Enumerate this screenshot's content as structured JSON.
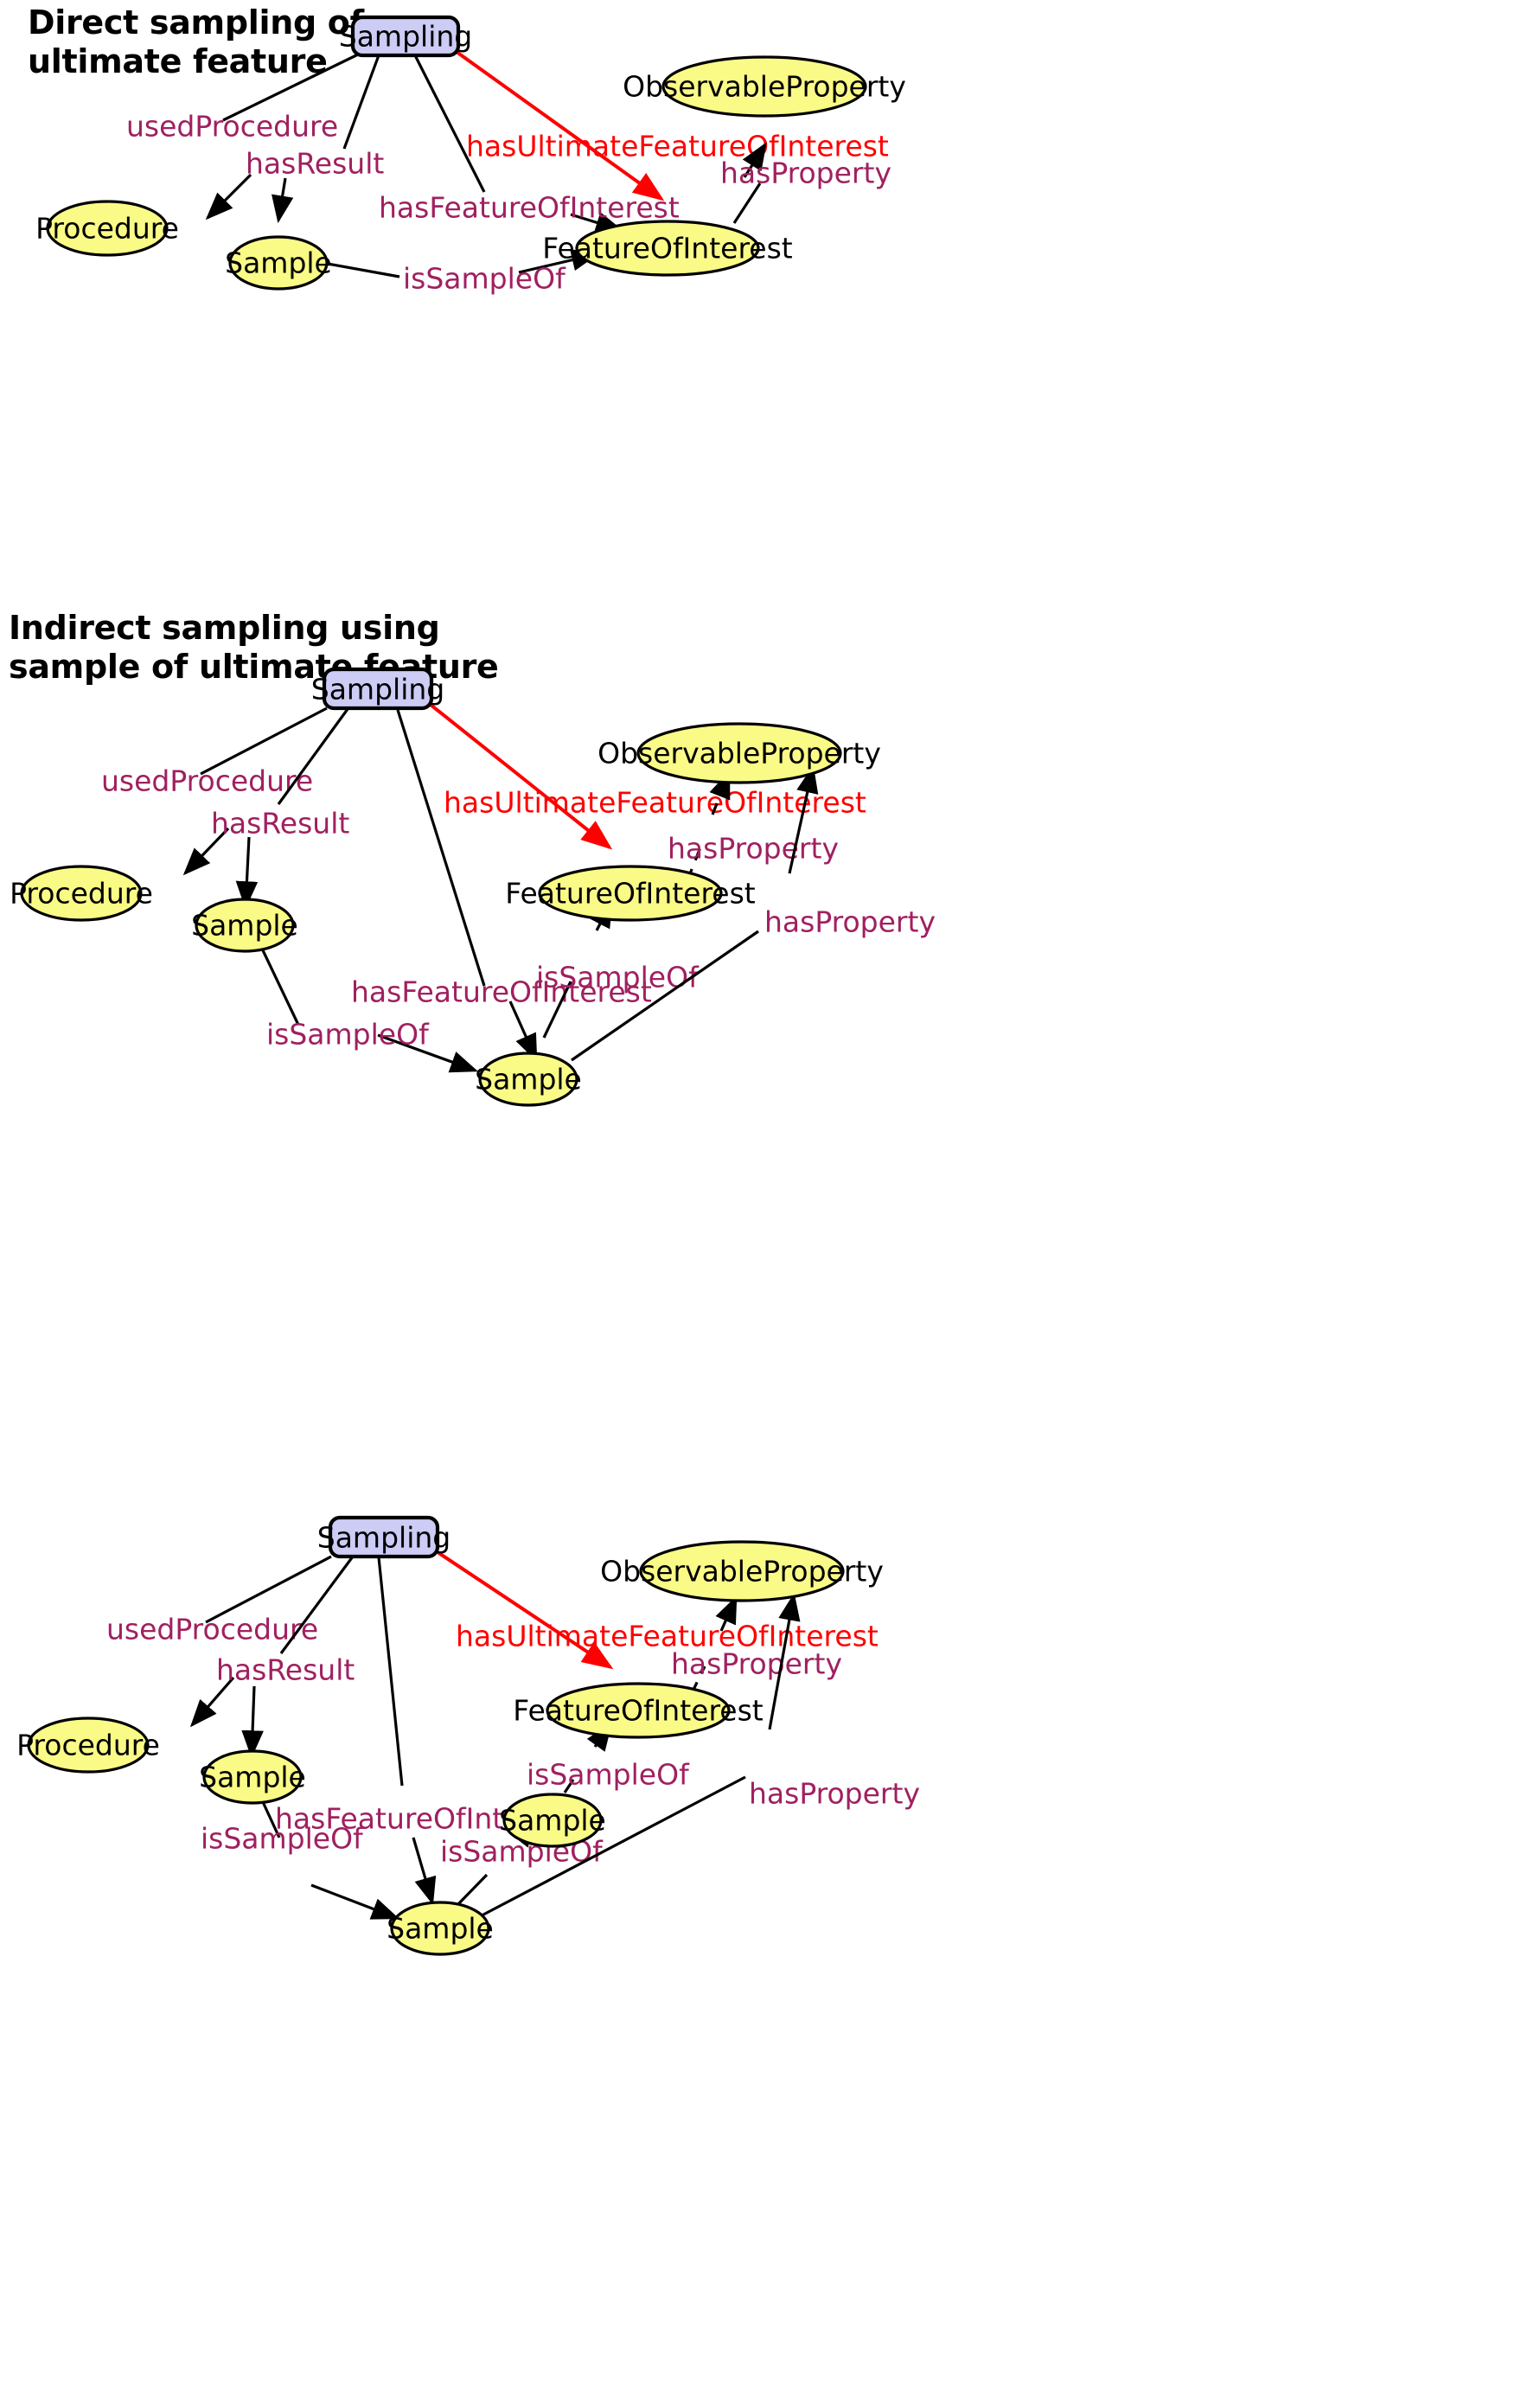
{
  "diagram": {
    "title_color": "#000000",
    "node_fill_ellipse": "#fafa87",
    "node_fill_box": "#ccccf5",
    "edge_label_color": "#a02060",
    "highlight_color": "#ff0000"
  },
  "panels": [
    {
      "id": "panel-direct",
      "title": "Direct sampling of\nultimate feature",
      "nodes": [
        {
          "id": "sampling",
          "label": "Sampling",
          "shape": "rounded-rect"
        },
        {
          "id": "procedure",
          "label": "Procedure",
          "shape": "ellipse"
        },
        {
          "id": "sample",
          "label": "Sample",
          "shape": "ellipse"
        },
        {
          "id": "foi",
          "label": "FeatureOfInterest",
          "shape": "ellipse"
        },
        {
          "id": "obsprop",
          "label": "ObservableProperty",
          "shape": "ellipse"
        }
      ],
      "edges": [
        {
          "id": "e1",
          "label": "usedProcedure",
          "from": "sampling",
          "to": "procedure",
          "style": "solid",
          "color": "black"
        },
        {
          "id": "e2",
          "label": "hasResult",
          "from": "sampling",
          "to": "sample",
          "style": "solid",
          "color": "black"
        },
        {
          "id": "e3",
          "label": "hasFeatureOfInterest",
          "from": "sampling",
          "to": "foi",
          "style": "solid",
          "color": "black"
        },
        {
          "id": "e4",
          "label": "hasUltimateFeatureOfInterest",
          "from": "sampling",
          "to": "foi",
          "style": "solid",
          "color": "red"
        },
        {
          "id": "e5",
          "label": "isSampleOf",
          "from": "sample",
          "to": "foi",
          "style": "solid",
          "color": "black"
        },
        {
          "id": "e6",
          "label": "hasProperty",
          "from": "foi",
          "to": "obsprop",
          "style": "solid",
          "color": "black"
        }
      ]
    },
    {
      "id": "panel-indirect",
      "title": "Indirect sampling using\nsample of ultimate feature",
      "nodes": [
        {
          "id": "sampling",
          "label": "Sampling",
          "shape": "rounded-rect"
        },
        {
          "id": "procedure",
          "label": "Procedure",
          "shape": "ellipse"
        },
        {
          "id": "sample1",
          "label": "Sample",
          "shape": "ellipse"
        },
        {
          "id": "sample2",
          "label": "Sample",
          "shape": "ellipse"
        },
        {
          "id": "foi",
          "label": "FeatureOfInterest",
          "shape": "ellipse"
        },
        {
          "id": "obsprop",
          "label": "ObservableProperty",
          "shape": "ellipse"
        }
      ],
      "edges": [
        {
          "id": "e1",
          "label": "usedProcedure",
          "from": "sampling",
          "to": "procedure",
          "style": "solid",
          "color": "black"
        },
        {
          "id": "e2",
          "label": "hasResult",
          "from": "sampling",
          "to": "sample1",
          "style": "solid",
          "color": "black"
        },
        {
          "id": "e3",
          "label": "hasFeatureOfInterest",
          "from": "sampling",
          "to": "sample2",
          "style": "solid",
          "color": "black"
        },
        {
          "id": "e4",
          "label": "hasUltimateFeatureOfInterest",
          "from": "sampling",
          "to": "foi",
          "style": "solid",
          "color": "red"
        },
        {
          "id": "e5",
          "label": "isSampleOf",
          "from": "sample1",
          "to": "sample2",
          "style": "solid",
          "color": "black"
        },
        {
          "id": "e6",
          "label": "isSampleOf",
          "from": "sample2",
          "to": "foi",
          "style": "solid",
          "color": "black"
        },
        {
          "id": "e7",
          "label": "hasProperty",
          "from": "foi",
          "to": "obsprop",
          "style": "dashed",
          "color": "black"
        },
        {
          "id": "e8",
          "label": "hasProperty",
          "from": "sample2",
          "to": "obsprop",
          "style": "solid",
          "color": "black"
        }
      ]
    },
    {
      "id": "panel-indirect-chain",
      "title": "",
      "nodes": [
        {
          "id": "sampling",
          "label": "Sampling",
          "shape": "rounded-rect"
        },
        {
          "id": "procedure",
          "label": "Procedure",
          "shape": "ellipse"
        },
        {
          "id": "sample1",
          "label": "Sample",
          "shape": "ellipse"
        },
        {
          "id": "sample2",
          "label": "Sample",
          "shape": "ellipse"
        },
        {
          "id": "sample3",
          "label": "Sample",
          "shape": "ellipse"
        },
        {
          "id": "foi",
          "label": "FeatureOfInterest",
          "shape": "ellipse"
        },
        {
          "id": "obsprop",
          "label": "ObservableProperty",
          "shape": "ellipse"
        }
      ],
      "edges": [
        {
          "id": "e1",
          "label": "usedProcedure",
          "from": "sampling",
          "to": "procedure",
          "style": "solid",
          "color": "black"
        },
        {
          "id": "e2",
          "label": "hasResult",
          "from": "sampling",
          "to": "sample1",
          "style": "solid",
          "color": "black"
        },
        {
          "id": "e3",
          "label": "hasFeatureOfInterest",
          "from": "sampling",
          "to": "sample2",
          "style": "solid",
          "color": "black"
        },
        {
          "id": "e4",
          "label": "hasUltimateFeatureOfInterest",
          "from": "sampling",
          "to": "foi",
          "style": "solid",
          "color": "red"
        },
        {
          "id": "e5",
          "label": "isSampleOf",
          "from": "sample1",
          "to": "sample2",
          "style": "solid",
          "color": "black"
        },
        {
          "id": "e6",
          "label": "isSampleOf",
          "from": "sample2",
          "to": "sample3",
          "style": "solid",
          "color": "black"
        },
        {
          "id": "e7",
          "label": "isSampleOf",
          "from": "sample3",
          "to": "foi",
          "style": "solid",
          "color": "black"
        },
        {
          "id": "e8",
          "label": "hasProperty",
          "from": "foi",
          "to": "obsprop",
          "style": "dashed",
          "color": "black"
        },
        {
          "id": "e9",
          "label": "hasProperty",
          "from": "sample2",
          "to": "obsprop",
          "style": "solid",
          "color": "black"
        }
      ]
    }
  ]
}
